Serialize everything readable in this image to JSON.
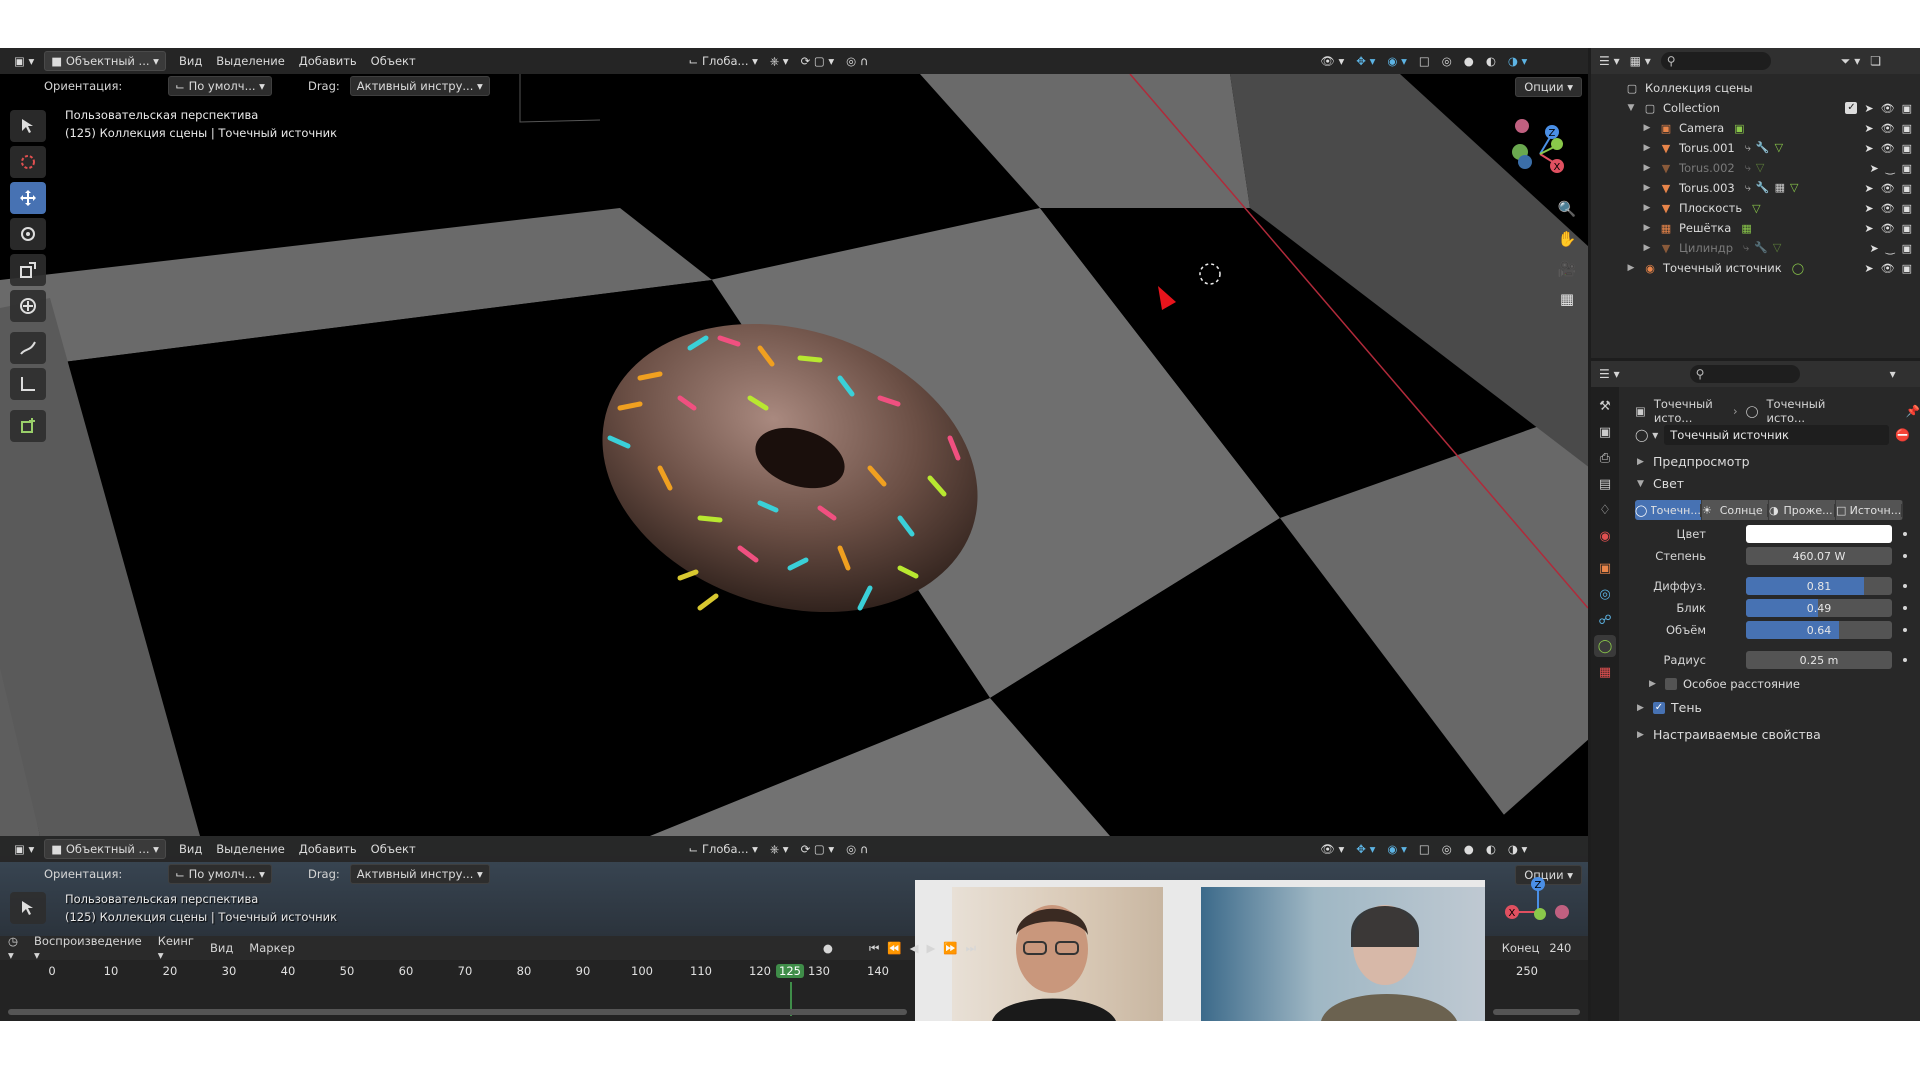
{
  "viewport_top": {
    "header": {
      "mode": "Объектный ...",
      "menus": [
        "Вид",
        "Выделение",
        "Добавить",
        "Объект"
      ],
      "transform_orientation": "Глоба..."
    },
    "tool_header": {
      "orientation_label": "Ориентация:",
      "orientation_value": "По умолч...",
      "drag_label": "Drag:",
      "drag_value": "Активный инстру...",
      "options_label": "Опции"
    },
    "overlay_line1": "Пользовательская перспектива",
    "overlay_line2": "(125) Коллекция сцены | Точечный источник"
  },
  "viewport_bottom": {
    "header": {
      "mode": "Объектный ...",
      "menus": [
        "Вид",
        "Выделение",
        "Добавить",
        "Объект"
      ],
      "transform_orientation": "Глоба..."
    },
    "tool_header": {
      "orientation_label": "Ориентация:",
      "orientation_value": "По умолч...",
      "drag_label": "Drag:",
      "drag_value": "Активный инстру...",
      "options_label": "Опции"
    },
    "overlay_line1": "Пользовательская перспектива",
    "overlay_line2": "(125) Коллекция сцены | Точечный источник"
  },
  "timeline": {
    "menus": [
      "Воспроизведение",
      "Кеинг",
      "Вид",
      "Маркер"
    ],
    "ticks": [
      "0",
      "10",
      "20",
      "30",
      "40",
      "50",
      "60",
      "70",
      "80",
      "90",
      "100",
      "110",
      "120",
      "130",
      "140"
    ],
    "current_frame": "125",
    "end_label": "Конец",
    "end_value": "240",
    "right_tick": "250"
  },
  "outliner": {
    "scene_collection": "Коллекция сцены",
    "collection": "Collection",
    "items": [
      {
        "name": "Camera",
        "kind": "camera",
        "dim": false
      },
      {
        "name": "Torus.001",
        "kind": "mesh",
        "dim": false
      },
      {
        "name": "Torus.002",
        "kind": "mesh",
        "dim": true
      },
      {
        "name": "Torus.003",
        "kind": "mesh",
        "dim": false
      },
      {
        "name": "Плоскость",
        "kind": "mesh",
        "dim": false
      },
      {
        "name": "Решётка",
        "kind": "lattice",
        "dim": false
      },
      {
        "name": "Цилиндр",
        "kind": "mesh",
        "dim": true
      }
    ],
    "light_item": "Точечный источник"
  },
  "properties": {
    "breadcrumb_1": "Точечный исто...",
    "breadcrumb_2": "Точечный исто...",
    "datablock_name": "Точечный источник",
    "section_preview": "Предпросмотр",
    "section_light": "Свет",
    "light_types": [
      "Точечн...",
      "Солнце",
      "Проже...",
      "Источн..."
    ],
    "active_light_type": 0,
    "color_label": "Цвет",
    "color_value": "#ffffff",
    "power_label": "Степень",
    "power_value": "460.07 W",
    "diffuse_label": "Диффуз.",
    "diffuse_value": "0.81",
    "specular_label": "Блик",
    "specular_value": "0.49",
    "volume_label": "Объём",
    "volume_value": "0.64",
    "radius_label": "Радиус",
    "radius_value": "0.25 m",
    "custom_distance_label": "Особое расстояние",
    "shadow_label": "Тень",
    "custom_props_label": "Настраиваемые свойства"
  },
  "colors": {
    "accent": "#4772b3",
    "frame_indicator": "#3f8d49",
    "panel_bg": "#282828",
    "header_bg": "#303030"
  }
}
